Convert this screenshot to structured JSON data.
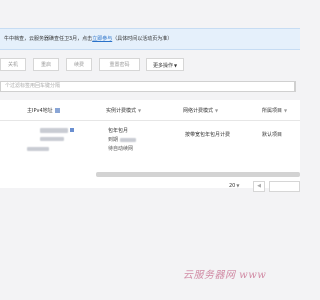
{
  "banner": {
    "text_before_link": "牛中档查，云服务器磺查任卫3月，点击",
    "link": "立即参与",
    "text_after_link": "（具体时间以活动页为准）"
  },
  "toolbar": {
    "btn1": "关机",
    "btn2": "重启",
    "btn3": "续费",
    "btn4": "重置密码",
    "more": "更多操作"
  },
  "search": {
    "placeholder": "个过滤标签用回车键分隔"
  },
  "table": {
    "headers": {
      "ip": "主IPv4地址",
      "instance_billing": "实例计费模式",
      "network_billing": "网络计费模式",
      "project": "所属项目"
    },
    "row": {
      "instance_billing_line1": "包年包月",
      "instance_billing_line2": "到期",
      "instance_billing_line3": "待自动续网",
      "network_billing": "按带宽包年包月计费",
      "project": "默认项目"
    }
  },
  "pagination": {
    "page_size": "20",
    "prev": "◀"
  },
  "watermark": "云服务器网 www"
}
